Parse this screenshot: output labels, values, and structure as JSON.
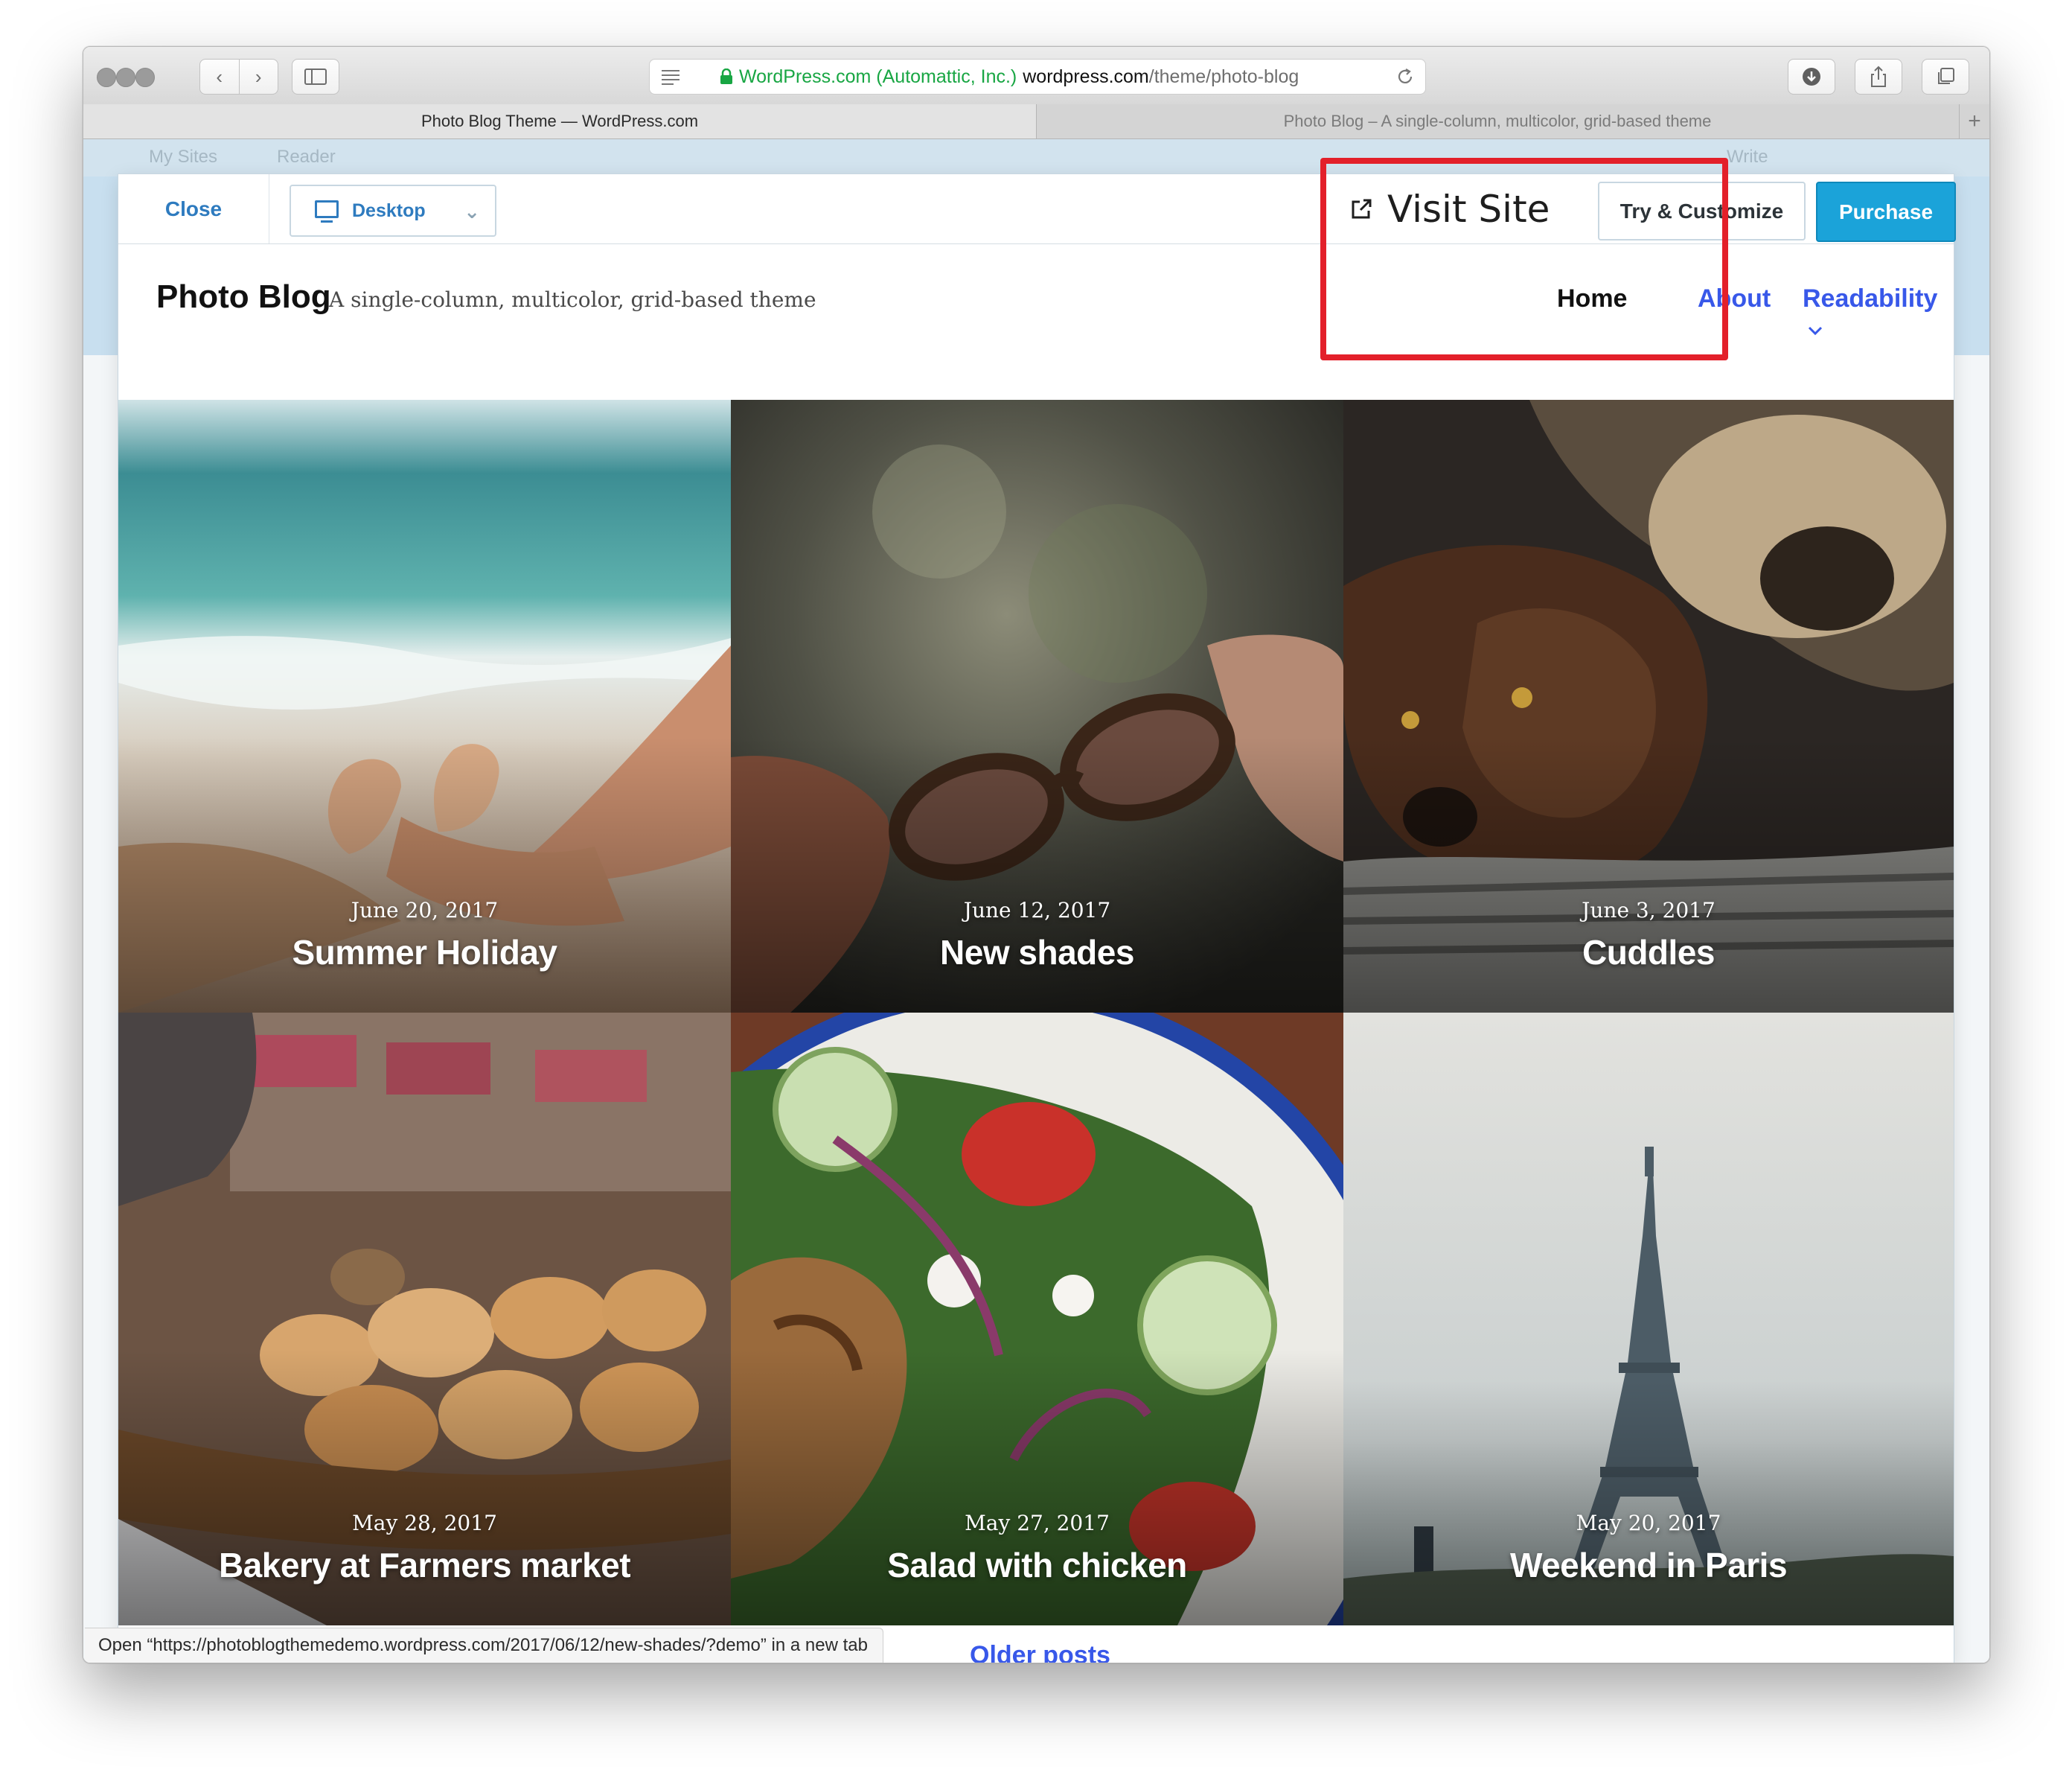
{
  "browser": {
    "url_secure": "WordPress.com (Automattic, Inc.)",
    "url_host": "wordpress.com",
    "url_path": "/theme/photo-blog",
    "tabs": [
      {
        "label": "Photo Blog Theme — WordPress.com"
      },
      {
        "label": "Photo Blog – A single-column, multicolor, grid-based theme"
      }
    ],
    "status_text": "Open “https://photoblogthemedemo.wordpress.com/2017/06/12/new-shades/?demo” in a new tab"
  },
  "wp_background": {
    "items": [
      "My Sites",
      "Reader",
      "Write"
    ]
  },
  "preview": {
    "close_label": "Close",
    "device_label": "Desktop",
    "visit_label": "Visit Site",
    "try_label": "Try & Customize",
    "purchase_label": "Purchase"
  },
  "site": {
    "title": "Photo Blog",
    "tagline": "A single-column, multicolor, grid-based theme",
    "menu": [
      {
        "label": "Home"
      },
      {
        "label": "About"
      },
      {
        "label": "Readability"
      }
    ]
  },
  "posts": [
    {
      "date": "June 20, 2017",
      "title": "Summer Holiday"
    },
    {
      "date": "June 12, 2017",
      "title": "New shades"
    },
    {
      "date": "June 3, 2017",
      "title": "Cuddles"
    },
    {
      "date": "May 28, 2017",
      "title": "Bakery at Farmers market"
    },
    {
      "date": "May 27, 2017",
      "title": "Salad with chicken"
    },
    {
      "date": "May 20, 2017",
      "title": "Weekend in Paris"
    }
  ],
  "older_posts_label": "Older posts",
  "colors": {
    "link": "#3858e9",
    "purchase": "#1ba3d9",
    "secure": "#18a643",
    "annotation": "#e3202a"
  }
}
